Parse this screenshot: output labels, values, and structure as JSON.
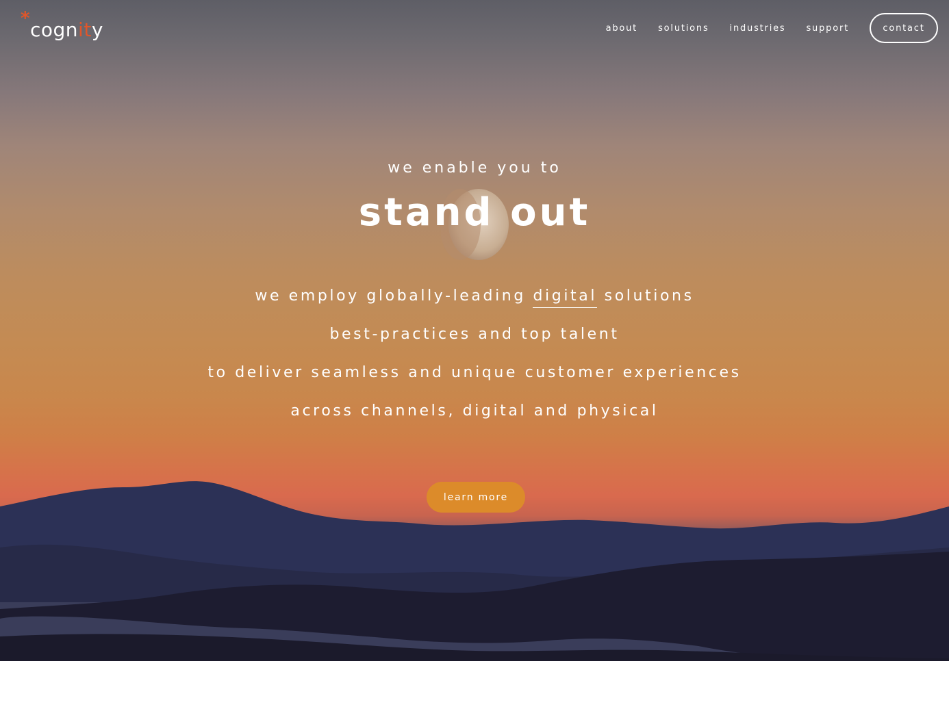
{
  "brand": {
    "logo_prefix": "cogn",
    "logo_accent": "it",
    "logo_suffix": "y",
    "asterisk": "*",
    "accent_color": "#e0562a"
  },
  "nav": {
    "items": [
      {
        "label": "about"
      },
      {
        "label": "solutions"
      },
      {
        "label": "industries"
      },
      {
        "label": "support"
      }
    ],
    "contact_label": "contact"
  },
  "hero": {
    "eyebrow": "we enable you to",
    "headline": "stand out",
    "line1_before": "we employ globally-leading ",
    "line1_highlight": "digital",
    "line1_after": " solutions",
    "line2": "best-practices and top talent",
    "line3": "to deliver seamless and unique customer experiences",
    "line4": "across channels, digital and physical",
    "cta_label": "learn more",
    "cta_color": "#dc8b2a"
  }
}
